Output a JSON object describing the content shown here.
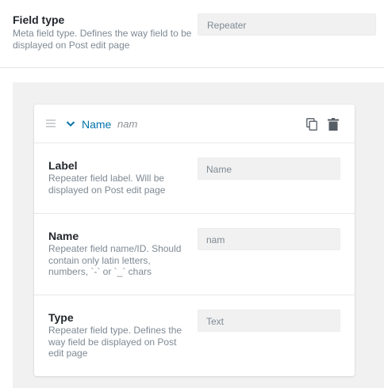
{
  "field_type": {
    "label": "Field type",
    "description": "Meta field type. Defines the way field to be displayed on Post edit page",
    "value": "Repeater"
  },
  "repeater_item": {
    "title": "Name",
    "slug": "nam",
    "icons": [
      "drag-handle-icon",
      "chevron-down-icon",
      "copy-icon",
      "trash-icon"
    ],
    "fields": [
      {
        "label": "Label",
        "description": "Repeater field label. Will be displayed on Post edit page",
        "value": "Name"
      },
      {
        "label": "Name",
        "description": "Repeater field name/ID. Should contain only latin letters, numbers, `-` or `_` chars",
        "value": "nam"
      },
      {
        "label": "Type",
        "description": "Repeater field type. Defines the way field be displayed on Post edit page",
        "value": "Text"
      }
    ]
  },
  "colors": {
    "accent": "#0073aa",
    "panel_bg": "#f1f1f1",
    "muted_text": "#7e8993"
  }
}
